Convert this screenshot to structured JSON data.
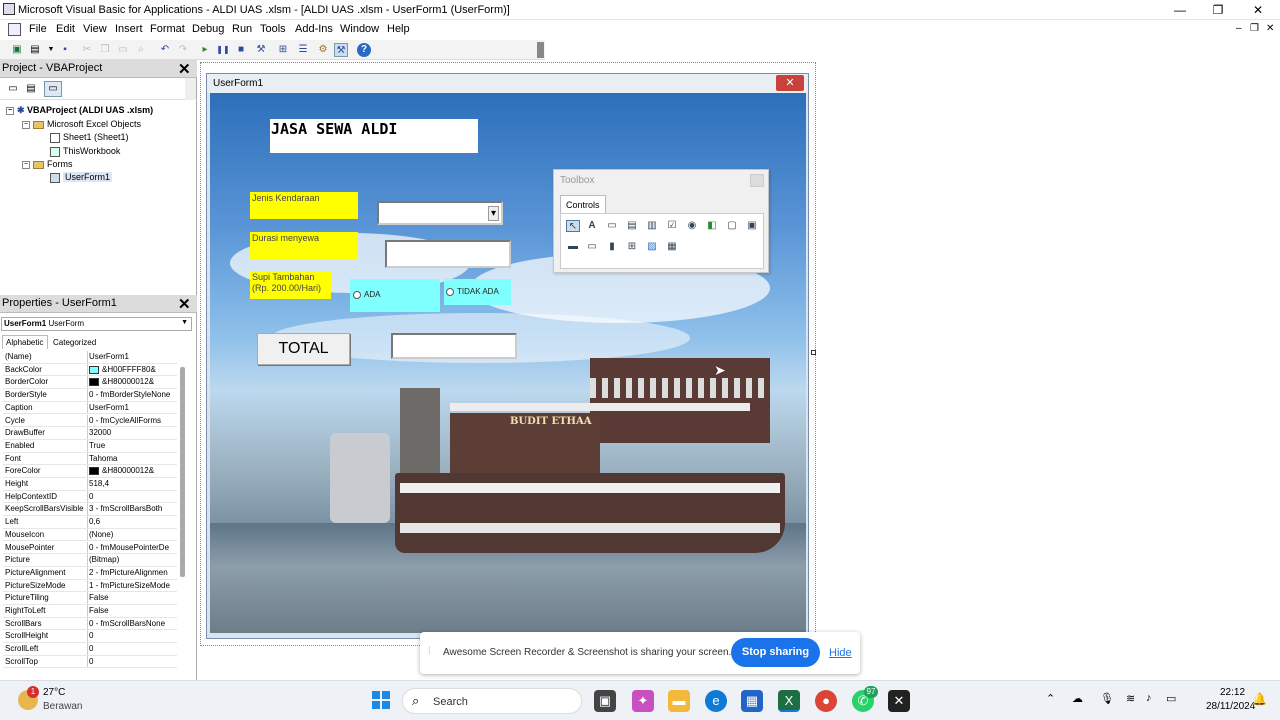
{
  "window": {
    "title": "Microsoft Visual Basic for Applications - ALDI UAS .xlsm - [ALDI UAS .xlsm - UserForm1 (UserForm)]",
    "min": "—",
    "max": "❐",
    "close": "✕"
  },
  "menu": [
    "File",
    "Edit",
    "View",
    "Insert",
    "Format",
    "Debug",
    "Run",
    "Tools",
    "Add-Ins",
    "Window",
    "Help"
  ],
  "mdi": {
    "min": "–",
    "restore": "❐",
    "close": "✕"
  },
  "project": {
    "title": "Project - VBAProject",
    "close": "✕",
    "root": "VBAProject (ALDI UAS .xlsm)",
    "excel_objects": "Microsoft Excel Objects",
    "sheet1": "Sheet1 (Sheet1)",
    "thisworkbook": "ThisWorkbook",
    "forms": "Forms",
    "userform": "UserForm1"
  },
  "properties": {
    "title": "Properties - UserForm1",
    "close": "✕",
    "object_name": "UserForm1",
    "object_type": "UserForm",
    "tab_alpha": "Alphabetic",
    "tab_cat": "Categorized",
    "rows": [
      {
        "n": "(Name)",
        "v": "UserForm1"
      },
      {
        "n": "BackColor",
        "v": "&H00FFFF80&",
        "c": "#80ffff"
      },
      {
        "n": "BorderColor",
        "v": "&H80000012&",
        "c": "#000000"
      },
      {
        "n": "BorderStyle",
        "v": "0 - fmBorderStyleNone"
      },
      {
        "n": "Caption",
        "v": "UserForm1"
      },
      {
        "n": "Cycle",
        "v": "0 - fmCycleAllForms"
      },
      {
        "n": "DrawBuffer",
        "v": "32000"
      },
      {
        "n": "Enabled",
        "v": "True"
      },
      {
        "n": "Font",
        "v": "Tahoma"
      },
      {
        "n": "ForeColor",
        "v": "&H80000012&",
        "c": "#000000"
      },
      {
        "n": "Height",
        "v": "518,4"
      },
      {
        "n": "HelpContextID",
        "v": "0"
      },
      {
        "n": "KeepScrollBarsVisible",
        "v": "3 - fmScrollBarsBoth"
      },
      {
        "n": "Left",
        "v": "0,6"
      },
      {
        "n": "MouseIcon",
        "v": "(None)"
      },
      {
        "n": "MousePointer",
        "v": "0 - fmMousePointerDe"
      },
      {
        "n": "Picture",
        "v": "(Bitmap)"
      },
      {
        "n": "PictureAlignment",
        "v": "2 - fmPictureAlignmen"
      },
      {
        "n": "PictureSizeMode",
        "v": "1 - fmPictureSizeMode"
      },
      {
        "n": "PictureTiling",
        "v": "False"
      },
      {
        "n": "RightToLeft",
        "v": "False"
      },
      {
        "n": "ScrollBars",
        "v": "0 - fmScrollBarsNone"
      },
      {
        "n": "ScrollHeight",
        "v": "0"
      },
      {
        "n": "ScrollLeft",
        "v": "0"
      },
      {
        "n": "ScrollTop",
        "v": "0"
      }
    ]
  },
  "userform": {
    "caption": "UserForm1",
    "close": "✕",
    "heading": "JASA SEWA ALDI",
    "label_kendaraan": "Jenis Kendaraan",
    "label_durasi": "Durasi menyewa",
    "label_supir": "Supi Tambahan\n(Rp. 200.00/Hari)",
    "opt_ada": "ADA",
    "opt_tidak": "TIDAK ADA",
    "total_button": "TOTAL",
    "combo_arrow": "▾",
    "boat_name": "BUDIT ETHAA"
  },
  "toolbox": {
    "title": "Toolbox",
    "tab": "Controls"
  },
  "share": {
    "message": "Awesome Screen Recorder & Screenshot is sharing your screen.",
    "stop": "Stop sharing",
    "hide": "Hide"
  },
  "taskbar": {
    "weather_temp": "27°C",
    "weather_desc": "Berawan",
    "weather_badge": "1",
    "search": "Search",
    "whatsapp_badge": "97",
    "time": "22:12",
    "date": "28/11/2024"
  }
}
